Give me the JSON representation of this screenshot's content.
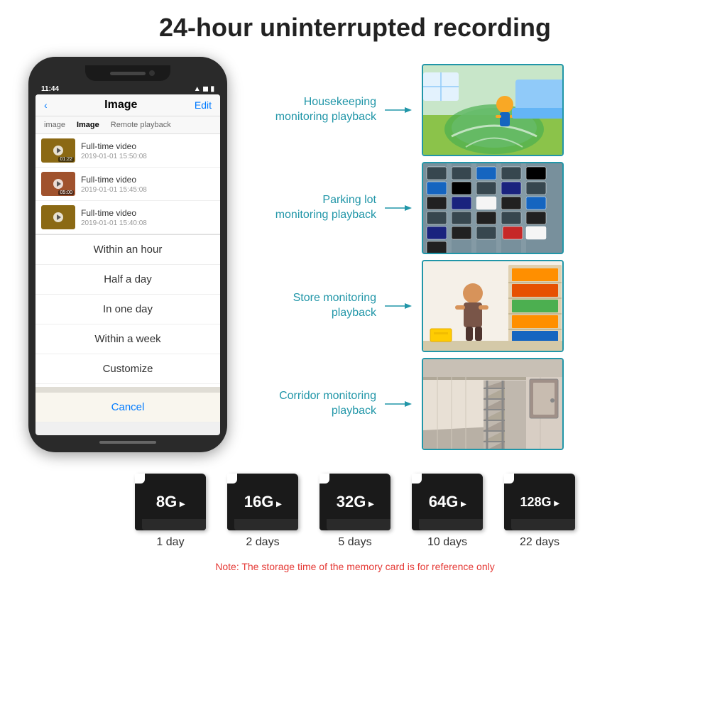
{
  "header": {
    "title": "24-hour uninterrupted recording"
  },
  "phone": {
    "time": "11:44",
    "nav": {
      "back": "‹",
      "title": "Image",
      "edit": "Edit"
    },
    "tabs": [
      "image",
      "Image",
      "Remote playback"
    ],
    "videos": [
      {
        "name": "Full-time video",
        "date": "2019-01-01 15:50:08",
        "duration": "01:22"
      },
      {
        "name": "Full-time video",
        "date": "2019-01-01 15:45:08",
        "duration": "05:00"
      },
      {
        "name": "Full-time video",
        "date": "2019-01-01 15:40:08",
        "duration": ""
      }
    ],
    "dropdown": {
      "items": [
        "Within an hour",
        "Half a day",
        "In one day",
        "Within a week",
        "Customize"
      ],
      "cancel": "Cancel"
    }
  },
  "monitoring": {
    "items": [
      {
        "label": "Housekeeping\nmonitoring playback",
        "scene": "housekeeping"
      },
      {
        "label": "Parking lot\nmonitoring playback",
        "scene": "parking"
      },
      {
        "label": "Store monitoring\nplayback",
        "scene": "store"
      },
      {
        "label": "Corridor monitoring\nplayback",
        "scene": "corridor"
      }
    ]
  },
  "storage": {
    "cards": [
      {
        "size": "8G",
        "days": "1 day"
      },
      {
        "size": "16G",
        "days": "2 days"
      },
      {
        "size": "32G",
        "days": "5 days"
      },
      {
        "size": "64G",
        "days": "10 days"
      },
      {
        "size": "128G",
        "days": "22 days"
      }
    ]
  },
  "note": {
    "text": "Note: The storage time of the memory card is for reference only"
  }
}
